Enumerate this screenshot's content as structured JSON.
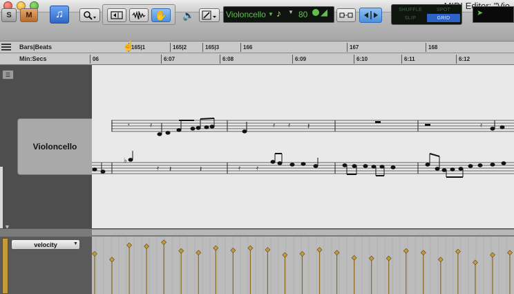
{
  "window": {
    "title": "MIDI Editor: \"Vio"
  },
  "toolbar": {
    "solo_label": "S",
    "mute_label": "M",
    "notation_icon": "music-note-icon",
    "track_name": "Violoncello",
    "default_velocity": "80",
    "modes": {
      "shuffle": "SHUFFLE",
      "spot": "SPOT",
      "slip": "SLIP",
      "grid": "GRID",
      "active": "GRID"
    },
    "colors": {
      "active_mode": "#2d62c6",
      "display_green": "#5ec24a",
      "selected_tool": "#4b8fdc"
    }
  },
  "rulers": {
    "bars_label": "Bars|Beats",
    "mins_label": "Min:Secs",
    "bars_ticks": [
      "165|1",
      "165|2",
      "165|3",
      "166",
      "167",
      "168"
    ],
    "min_ticks": [
      "06",
      "6:07",
      "6:08",
      "6:09",
      "6:10",
      "6:11",
      "6:12"
    ]
  },
  "track": {
    "name": "Violoncello"
  },
  "velocity_lane": {
    "label": "velocity",
    "color": "#c39a3c",
    "values": [
      0.7,
      0.6,
      0.85,
      0.83,
      0.9,
      0.75,
      0.72,
      0.8,
      0.76,
      0.8,
      0.77,
      0.68,
      0.7,
      0.77,
      0.72,
      0.63,
      0.62,
      0.62,
      0.75,
      0.72,
      0.6,
      0.74,
      0.55,
      0.68,
      0.72
    ]
  }
}
